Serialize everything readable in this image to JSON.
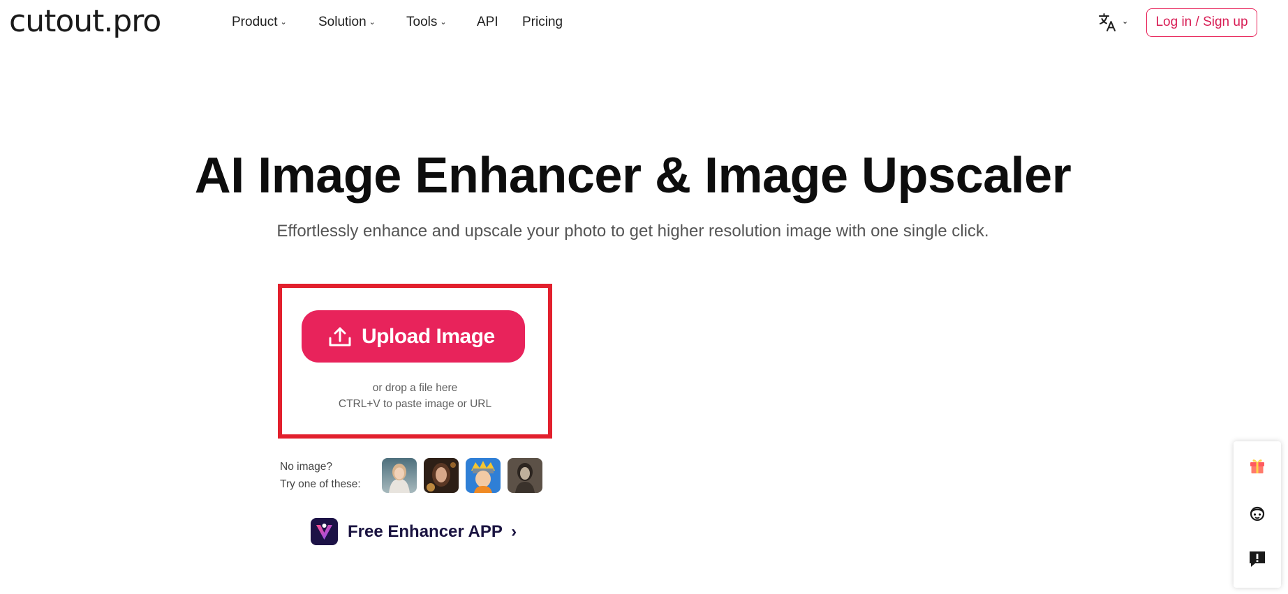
{
  "header": {
    "logo": "cutout.pro",
    "nav": [
      {
        "label": "Product",
        "dropdown": true
      },
      {
        "label": "Solution",
        "dropdown": true
      },
      {
        "label": "Tools",
        "dropdown": true
      },
      {
        "label": "API",
        "dropdown": false
      },
      {
        "label": "Pricing",
        "dropdown": false
      }
    ],
    "language_icon": "translate-icon",
    "login_label": "Log in / Sign up"
  },
  "hero": {
    "title": "AI Image Enhancer & Image Upscaler",
    "subtitle": "Effortlessly enhance and upscale your photo to get higher resolution image with one single click."
  },
  "upload": {
    "button_label": "Upload Image",
    "drop_hint": "or drop a file here",
    "paste_hint": "CTRL+V to paste image or URL"
  },
  "samples": {
    "label_line1": "No image?",
    "label_line2": "Try one of these:",
    "thumbnails": [
      "blonde-girl-portrait",
      "woman-portrait",
      "anime-ninja-character",
      "vintage-woman-portrait"
    ]
  },
  "app_link": {
    "label": "Free Enhancer APP",
    "chevron": "›"
  },
  "side_panel": {
    "icons": [
      "gift-icon",
      "support-agent-icon",
      "feedback-icon"
    ]
  },
  "colors": {
    "accent": "#e8235b",
    "highlight_border": "#e2202d",
    "app_text": "#1a1340"
  }
}
